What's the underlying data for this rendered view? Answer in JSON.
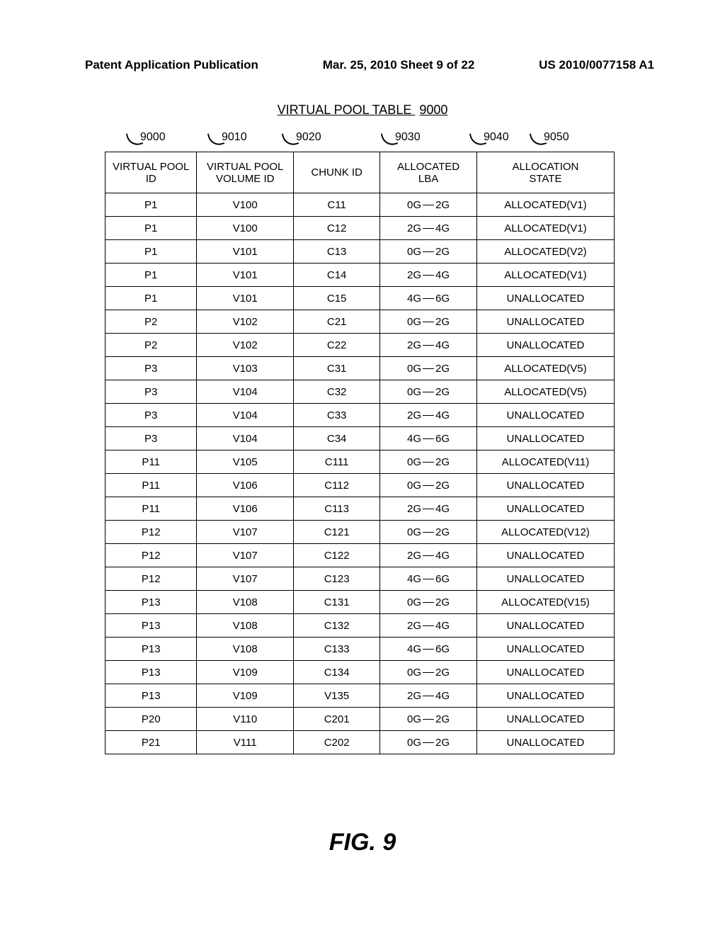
{
  "header": {
    "left": "Patent Application Publication",
    "center": "Mar. 25, 2010  Sheet 9 of 22",
    "right": "US 2010/0077158 A1"
  },
  "title": {
    "label": "VIRTUAL POOL TABLE",
    "number": "9000"
  },
  "callouts": [
    "9000",
    "9010",
    "9020",
    "9030",
    "9040",
    "9050"
  ],
  "columns": {
    "c1": [
      "VIRTUAL POOL",
      "ID"
    ],
    "c2": [
      "VIRTUAL POOL",
      "VOLUME ID"
    ],
    "c3": [
      "CHUNK ID"
    ],
    "c4": [
      "ALLOCATED",
      "LBA"
    ],
    "c5": [
      "ALLOCATION",
      "STATE"
    ]
  },
  "chart_data": {
    "type": "table",
    "rows": [
      {
        "pool": "P1",
        "vol": "V100",
        "chunk": "C11",
        "lba_lo": "0G",
        "lba_hi": "2G",
        "state": "ALLOCATED(V1)"
      },
      {
        "pool": "P1",
        "vol": "V100",
        "chunk": "C12",
        "lba_lo": "2G",
        "lba_hi": "4G",
        "state": "ALLOCATED(V1)"
      },
      {
        "pool": "P1",
        "vol": "V101",
        "chunk": "C13",
        "lba_lo": "0G",
        "lba_hi": "2G",
        "state": "ALLOCATED(V2)"
      },
      {
        "pool": "P1",
        "vol": "V101",
        "chunk": "C14",
        "lba_lo": "2G",
        "lba_hi": "4G",
        "state": "ALLOCATED(V1)"
      },
      {
        "pool": "P1",
        "vol": "V101",
        "chunk": "C15",
        "lba_lo": "4G",
        "lba_hi": "6G",
        "state": "UNALLOCATED"
      },
      {
        "pool": "P2",
        "vol": "V102",
        "chunk": "C21",
        "lba_lo": "0G",
        "lba_hi": "2G",
        "state": "UNALLOCATED"
      },
      {
        "pool": "P2",
        "vol": "V102",
        "chunk": "C22",
        "lba_lo": "2G",
        "lba_hi": "4G",
        "state": "UNALLOCATED"
      },
      {
        "pool": "P3",
        "vol": "V103",
        "chunk": "C31",
        "lba_lo": "0G",
        "lba_hi": "2G",
        "state": "ALLOCATED(V5)"
      },
      {
        "pool": "P3",
        "vol": "V104",
        "chunk": "C32",
        "lba_lo": "0G",
        "lba_hi": "2G",
        "state": "ALLOCATED(V5)"
      },
      {
        "pool": "P3",
        "vol": "V104",
        "chunk": "C33",
        "lba_lo": "2G",
        "lba_hi": "4G",
        "state": "UNALLOCATED"
      },
      {
        "pool": "P3",
        "vol": "V104",
        "chunk": "C34",
        "lba_lo": "4G",
        "lba_hi": "6G",
        "state": "UNALLOCATED"
      },
      {
        "pool": "P11",
        "vol": "V105",
        "chunk": "C111",
        "lba_lo": "0G",
        "lba_hi": "2G",
        "state": "ALLOCATED(V11)"
      },
      {
        "pool": "P11",
        "vol": "V106",
        "chunk": "C112",
        "lba_lo": "0G",
        "lba_hi": "2G",
        "state": "UNALLOCATED"
      },
      {
        "pool": "P11",
        "vol": "V106",
        "chunk": "C113",
        "lba_lo": "2G",
        "lba_hi": "4G",
        "state": "UNALLOCATED"
      },
      {
        "pool": "P12",
        "vol": "V107",
        "chunk": "C121",
        "lba_lo": "0G",
        "lba_hi": "2G",
        "state": "ALLOCATED(V12)"
      },
      {
        "pool": "P12",
        "vol": "V107",
        "chunk": "C122",
        "lba_lo": "2G",
        "lba_hi": "4G",
        "state": "UNALLOCATED"
      },
      {
        "pool": "P12",
        "vol": "V107",
        "chunk": "C123",
        "lba_lo": "4G",
        "lba_hi": "6G",
        "state": "UNALLOCATED"
      },
      {
        "pool": "P13",
        "vol": "V108",
        "chunk": "C131",
        "lba_lo": "0G",
        "lba_hi": "2G",
        "state": "ALLOCATED(V15)"
      },
      {
        "pool": "P13",
        "vol": "V108",
        "chunk": "C132",
        "lba_lo": "2G",
        "lba_hi": "4G",
        "state": "UNALLOCATED"
      },
      {
        "pool": "P13",
        "vol": "V108",
        "chunk": "C133",
        "lba_lo": "4G",
        "lba_hi": "6G",
        "state": "UNALLOCATED"
      },
      {
        "pool": "P13",
        "vol": "V109",
        "chunk": "C134",
        "lba_lo": "0G",
        "lba_hi": "2G",
        "state": "UNALLOCATED"
      },
      {
        "pool": "P13",
        "vol": "V109",
        "chunk": "V135",
        "lba_lo": "2G",
        "lba_hi": "4G",
        "state": "UNALLOCATED"
      },
      {
        "pool": "P20",
        "vol": "V110",
        "chunk": "C201",
        "lba_lo": "0G",
        "lba_hi": "2G",
        "state": "UNALLOCATED"
      },
      {
        "pool": "P21",
        "vol": "V111",
        "chunk": "C202",
        "lba_lo": "0G",
        "lba_hi": "2G",
        "state": "UNALLOCATED"
      }
    ]
  },
  "figure_label": "FIG. 9"
}
